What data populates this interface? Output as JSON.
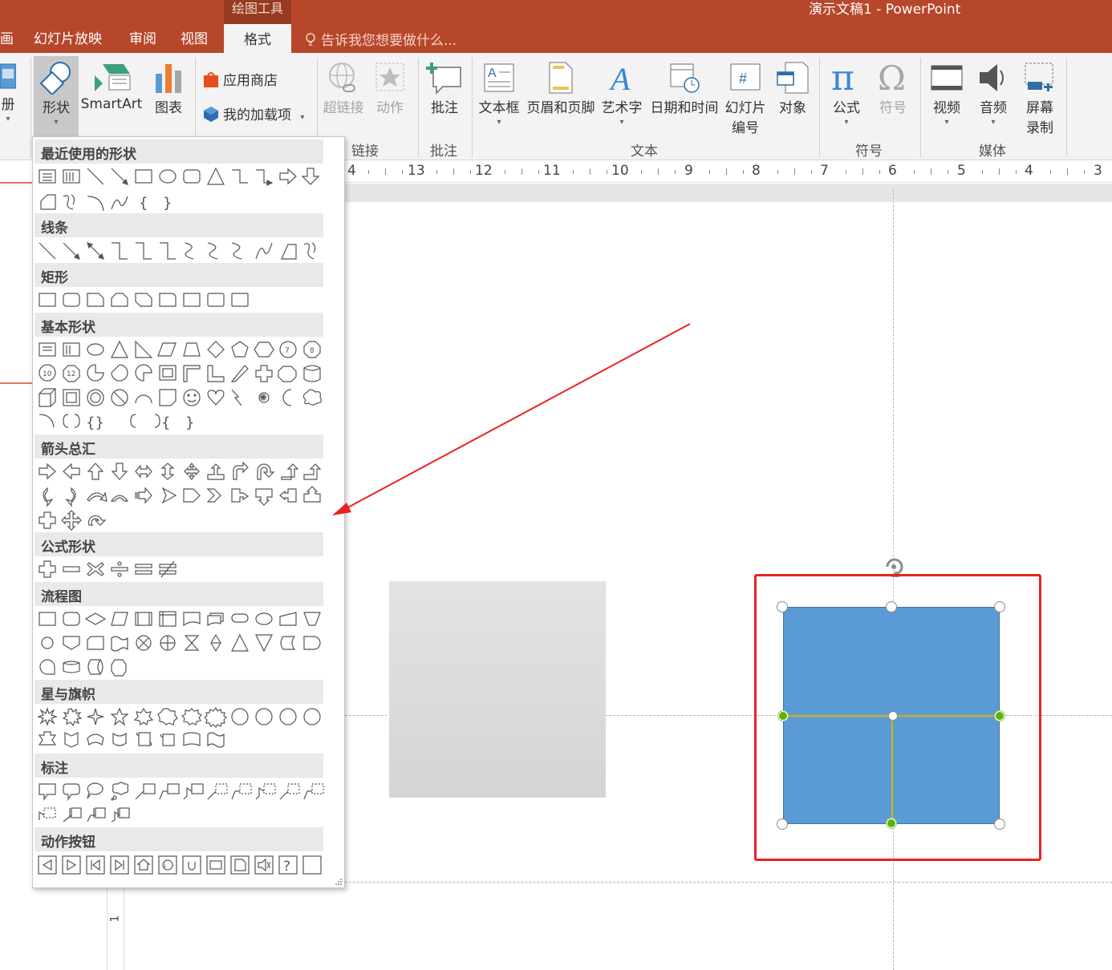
{
  "titlebar": {
    "context_group": "绘图工具",
    "doc_title": "演示文稿1 - PowerPoint",
    "tabs": [
      "画",
      "幻灯片放映",
      "审阅",
      "视图",
      "格式"
    ],
    "active_tab": "格式",
    "tell_me": "告诉我您想要做什么..."
  },
  "ribbon": {
    "partial_left_label": "册",
    "insert_group": {
      "shapes": "形状",
      "smartart": "SmartArt",
      "chart": "图表",
      "store": "应用商店",
      "my_addins": "我的加载项"
    },
    "links_group": {
      "label": "链接",
      "hyperlink": "超链接",
      "action": "动作"
    },
    "comments_group": {
      "label": "批注",
      "comment": "批注"
    },
    "text_group": {
      "label": "文本",
      "textbox": "文本框",
      "header_footer": "页眉和页脚",
      "wordart": "艺术字",
      "datetime": "日期和时间",
      "slide_number_1": "幻灯片",
      "slide_number_2": "编号",
      "object": "对象"
    },
    "symbols_group": {
      "label": "符号",
      "equation": "公式",
      "symbol": "符号"
    },
    "media_group": {
      "label": "媒体",
      "video": "视频",
      "audio": "音频",
      "screen_1": "屏幕",
      "screen_2": "录制"
    }
  },
  "ruler": {
    "h_numbers": [
      "4",
      "13",
      "12",
      "11",
      "10",
      "9",
      "8",
      "7",
      "6",
      "5",
      "4",
      "3"
    ],
    "v_number": "1"
  },
  "gallery": {
    "categories": {
      "recent": "最近使用的形状",
      "lines": "线条",
      "rectangles": "矩形",
      "basic": "基本形状",
      "arrows": "箭头总汇",
      "equation": "公式形状",
      "flowchart": "流程图",
      "stars": "星与旗帜",
      "callouts": "标注",
      "action_buttons": "动作按钮"
    },
    "shape_numbers": [
      "7",
      "8",
      "10",
      "12"
    ]
  },
  "colors": {
    "title_bar": "#b7472a",
    "ribbon": "#f3f3f3",
    "shape_fill": "#5b9bd5",
    "highlight_frame": "#e8231f",
    "annotation_arrow": "#e8231f",
    "adjust_handle": "#5bb30a"
  }
}
